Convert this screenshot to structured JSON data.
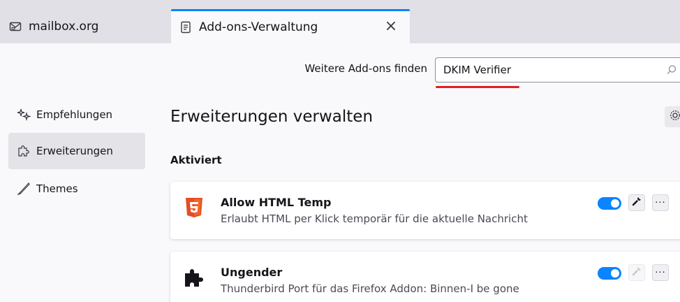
{
  "tabs": [
    {
      "label": "mailbox.org",
      "icon": "mail-icon",
      "active": false
    },
    {
      "label": "Add-ons-Verwaltung",
      "icon": "document-icon",
      "active": true
    }
  ],
  "tab_close_label": "×",
  "search": {
    "label": "Weitere Add-ons finden",
    "value": "DKIM Verifier"
  },
  "sidebar": {
    "items": [
      {
        "label": "Empfehlungen",
        "icon": "sparkle-icon",
        "selected": false
      },
      {
        "label": "Erweiterungen",
        "icon": "puzzle-icon",
        "selected": true
      },
      {
        "label": "Themes",
        "icon": "brush-icon",
        "selected": false
      }
    ]
  },
  "main": {
    "title": "Erweiterungen verwalten",
    "section": "Aktiviert",
    "addons": [
      {
        "name": "Allow HTML Temp",
        "description": "Erlaubt HTML per Klick temporär für die aktuelle Nachricht",
        "icon": "html5-icon",
        "enabled": true,
        "preferences_enabled": true
      },
      {
        "name": "Ungender",
        "description": "Thunderbird Port für das Firefox Addon: Binnen-I be gone",
        "icon": "puzzle-icon",
        "enabled": true,
        "preferences_enabled": false
      }
    ]
  },
  "more_label": "···",
  "colors": {
    "accent": "#0a84ff",
    "underline": "#e22020",
    "html5": "#e44d26"
  }
}
